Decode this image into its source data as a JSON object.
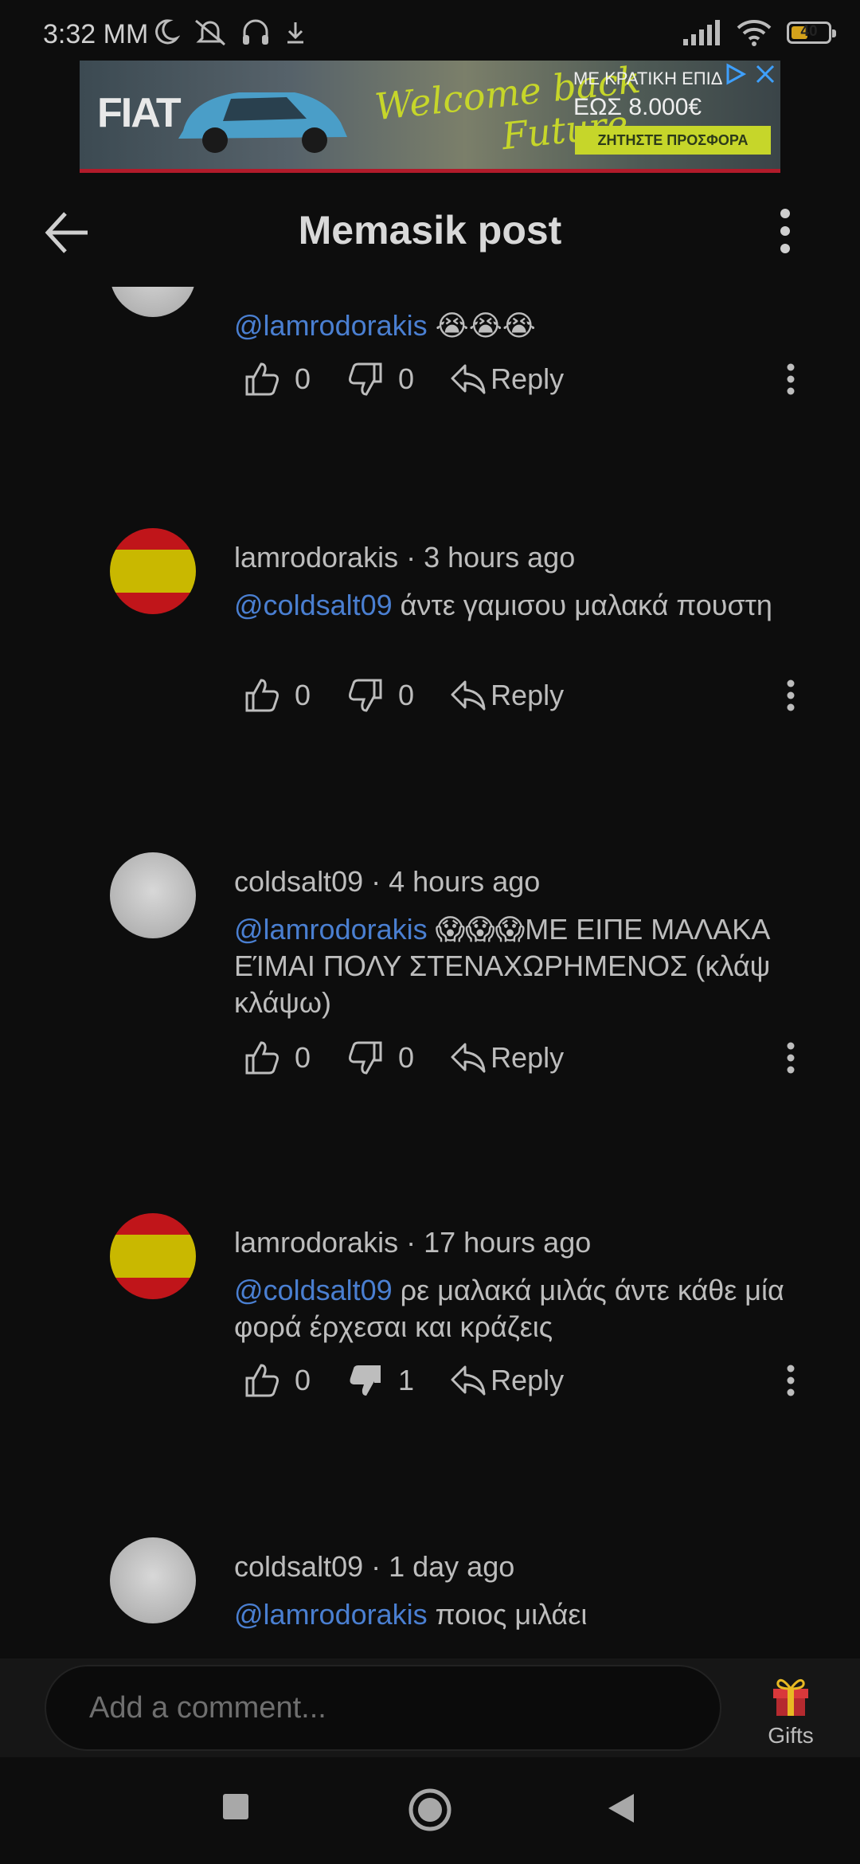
{
  "status_bar": {
    "time": "3:32 MM",
    "battery_level": "40",
    "icons": [
      "moon-icon",
      "bell-off-icon",
      "headphones-icon",
      "download-icon",
      "signal-icon",
      "wifi-icon",
      "battery-icon"
    ]
  },
  "ad": {
    "brand": "FIAT",
    "headline_1": "Welcome back",
    "headline_2": "Future",
    "line_1": "ΜΕ ΚΡΑΤΙΚΗ ΕΠΙΔ",
    "line_2": "ΕΩΣ 8.000€",
    "cta": "ΖΗΤΗΣΤΕ ΠΡΟΣΦΟΡΑ",
    "accent_color": "#c6d62a"
  },
  "header": {
    "title": "Memasik post"
  },
  "comments": [
    {
      "author": "",
      "time": "",
      "avatar": "windows-logo",
      "mention": "@lamrodorakis",
      "text": " 😭😭😭",
      "likes": "0",
      "dislikes": "0",
      "reply_label": "Reply"
    },
    {
      "author": "lamrodorakis",
      "time": "3 hours ago",
      "avatar": "spain-flag",
      "mention": "@coldsalt09",
      "text": "  άντε γαμισου μαλακά πουστη",
      "likes": "0",
      "dislikes": "0",
      "reply_label": "Reply"
    },
    {
      "author": "coldsalt09",
      "time": "4 hours ago",
      "avatar": "windows-logo",
      "mention": "@lamrodorakis",
      "text": " 😱😱😱ΜΕ ΕΙΠΕ ΜΑΛΑΚΑ ΕΊΜΑΙ ΠΟΛΥ ΣΤΕΝΑΧΩΡΗΜΕΝΟΣ (κλάψ κλάψω)",
      "likes": "0",
      "dislikes": "0",
      "reply_label": "Reply"
    },
    {
      "author": "lamrodorakis",
      "time": "17 hours ago",
      "avatar": "spain-flag",
      "mention": "@coldsalt09",
      "text": "  ρε μαλακά μιλάς άντε κάθε μία φορά έρχεσαι και κράζεις",
      "likes": "0",
      "dislikes": "1",
      "reply_label": "Reply"
    },
    {
      "author": "coldsalt09",
      "time": "1 day ago",
      "avatar": "windows-logo",
      "mention": "@lamrodorakis",
      "text": " ποιος μιλάει"
    }
  ],
  "composer": {
    "placeholder": "Add a comment...",
    "gifts_label": "Gifts"
  },
  "nav_bar": {
    "buttons": [
      "recents-square-icon",
      "home-circle-icon",
      "back-triangle-icon"
    ]
  }
}
